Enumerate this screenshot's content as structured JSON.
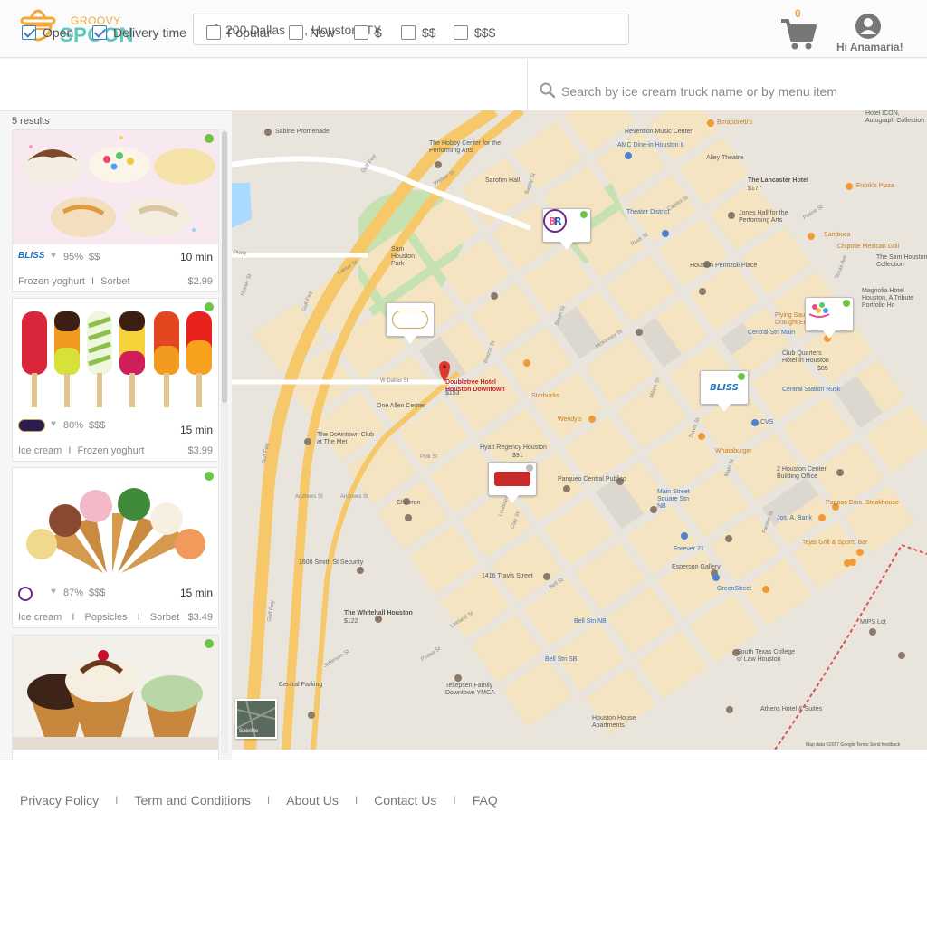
{
  "header": {
    "logo_line1": "GROOVY",
    "logo_line2": "SPOON",
    "address": "200 Dallas St., Houston, TX",
    "cart_count": "0",
    "greeting": "Hi Anamaria!"
  },
  "filters": [
    {
      "label": "Open",
      "checked": true
    },
    {
      "label": "Delivery time",
      "checked": true
    },
    {
      "label": "Popular",
      "checked": false
    },
    {
      "label": "New",
      "checked": false
    },
    {
      "label": "$",
      "checked": false
    },
    {
      "label": "$$",
      "checked": false
    },
    {
      "label": "$$$",
      "checked": false
    }
  ],
  "search": {
    "placeholder": "Search by ice cream truck name or by menu item"
  },
  "results": {
    "count_label": "5 results",
    "items": [
      {
        "brand": "BLISS",
        "rating": "95%",
        "price_level": "$$",
        "eta": "10 min",
        "tags": [
          "Frozen yoghurt",
          "Sorbet"
        ],
        "price": "$2.99",
        "open": true
      },
      {
        "brand": "Häagen-Dazs",
        "rating": "80%",
        "price_level": "$$$",
        "eta": "15 min",
        "tags": [
          "Ice cream",
          "Frozen yoghurt"
        ],
        "price": "$3.99",
        "open": true
      },
      {
        "brand": "Baskin Robbins",
        "rating": "87%",
        "price_level": "$$$",
        "eta": "15 min",
        "tags": [
          "Ice cream",
          "Popsicles",
          "Sorbet"
        ],
        "price": "$3.49",
        "open": true
      },
      {
        "brand": "",
        "rating": "",
        "price_level": "",
        "eta": "",
        "tags": [],
        "price": "",
        "open": true
      }
    ]
  },
  "map": {
    "satellite_label": "Satellite",
    "attribution": "Map data ©2017 Google   Terms   Send feedback",
    "labels": {
      "sabine_promenade": "Sabine Promenade",
      "hobby_center": "The Hobby Center for the Performing Arts",
      "revention": "Revention Music Center",
      "amc": "AMC Dine-in Houston 8",
      "alley_theatre": "Alley Theatre",
      "birraporetti": "Birraporetti's",
      "sarofim_hall": "Sarofim Hall",
      "lancaster_hotel": "The Lancaster Hotel",
      "lancaster_price": "$177",
      "franks_pizza": "Frank's Pizza",
      "hotel_icon": "Hotel ICON, Autograph Collection",
      "theater_district": "Theater District",
      "jones_hall": "Jones Hall for the Performing Arts",
      "sam_houston_park": "Sam Houston Park",
      "sambuca": "Sambuca",
      "chipotle": "Chipotle Mexican Grill",
      "sam_houston_collection": "The Sam Houston Collection",
      "houston_pennzoil": "Houston Pennzoil Place",
      "magnolia": "Magnolia Hotel Houston, A Tribute Portfolio Ho",
      "flying_saucer": "Flying Saucer Draught Empo",
      "central_station_main": "Central Stn Main",
      "club_quarters": "Club Quarters Hotel in Houston",
      "club_quarters_price": "$85",
      "doubletree": "Doubletree Hotel Houston Downtown",
      "doubletree_price": "$153",
      "starbucks": "Starbucks",
      "central_station_rusk": "Central Station Rusk",
      "one_allen_center": "One Allen Center",
      "wendys": "Wendy's",
      "cvs": "CVS",
      "downtown_club": "The Downtown Club at The Met",
      "hyatt": "Hyatt Regency Houston",
      "hyatt_price": "$91",
      "whataburger": "Whataburger",
      "parqueo": "Parqueo Central Publico",
      "two_houston_center": "2 Houston Center Building Office",
      "chevron": "Chevron",
      "main_street_square": "Main Street Square Stn NB",
      "pappas": "Pappas Bros. Steakhouse",
      "jos_a_bank": "Jos. A. Bank",
      "tejas_grill": "Tejas Grill & Sports Bar",
      "smith_security": "1600 Smith St Security",
      "travis_1416": "1416 Travis Street",
      "forever21": "Forever 21",
      "esperson": "Esperson Gallery",
      "greenstreet": "GreenStreet",
      "whitehall": "The Whitehall Houston",
      "whitehall_price": "$122",
      "bell_stn_nb": "Bell Stn NB",
      "mips_lot": "MIPS Lot",
      "bell_stn_sb": "Bell Stn SB",
      "south_texas_college": "South Texas College of Law Houston",
      "tellepsen": "Tellepsen Family Downtown YMCA",
      "central_parking": "Central Parking",
      "athens_hotel": "Athens Hotel & Suites",
      "houston_house": "Houston House Apartments",
      "gulf_fwy": "Gulf Fwy",
      "walker_st": "Walker St",
      "lamar_st": "Lamar St",
      "w_dallas_st": "W Dallas St",
      "polk_st": "Polk St",
      "andrews_st": "Andrews St",
      "bagby_st": "Bagby St",
      "smith_st": "Smith St",
      "milam_st": "Milam St",
      "travis_st": "Travis St",
      "main_st": "Main St",
      "fannin_st": "Fannin St",
      "san_jacinto_st": "San Jacinto St",
      "caroline_st": "Caroline St",
      "louisiana_st": "Louisiana St",
      "capitol_st": "Capitol St",
      "rusk_st": "Rusk St",
      "prairie_st": "Prairie St",
      "texas_ave": "Texas Ave",
      "mckinney_st": "McKinney St",
      "clay_st": "Clay St",
      "leeland_st": "Leeland St",
      "pease_st": "Pease St",
      "jefferson_st": "Jefferson St",
      "pierce_st": "Pierce St",
      "bell_st": "Bell St",
      "brazos_st": "Brazos St",
      "heiner_st": "Heiner St",
      "pkwy": "Pkwy",
      "hwy_45": "45",
      "hwy_527": "527",
      "hwy_476": "476"
    },
    "pins": [
      {
        "brand": "BR",
        "status": "open"
      },
      {
        "brand": "Häagen-Dazs",
        "status": "none"
      },
      {
        "brand": "confetti",
        "status": "open"
      },
      {
        "brand": "BLISS",
        "status": "open"
      },
      {
        "brand": "ICE CREAM",
        "status": "closed"
      }
    ]
  },
  "footer": {
    "links": [
      "Privacy Policy",
      "Term and Conditions",
      "About Us",
      "Contact Us",
      "FAQ"
    ],
    "separator": "I"
  },
  "colors": {
    "brand_orange": "#f3a93a",
    "brand_teal": "#5cc8c0",
    "checkbox_blue": "#3c7fc0",
    "open_green": "#6cc644"
  }
}
